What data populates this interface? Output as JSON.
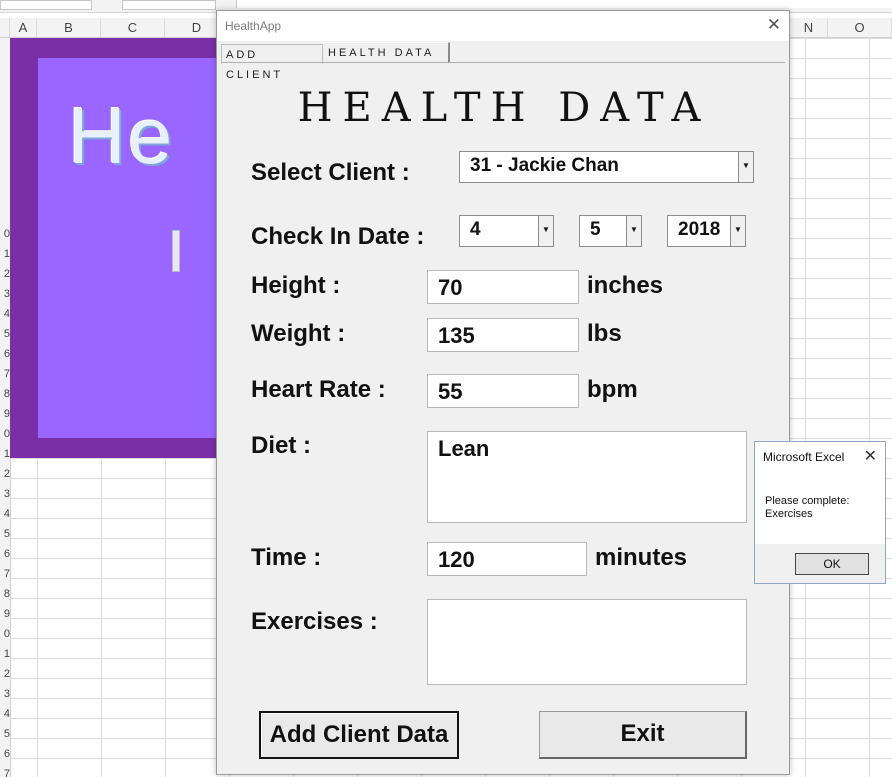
{
  "excel": {
    "columns_left": [
      "A",
      "B",
      "C",
      "D"
    ],
    "columns_right": [
      "N",
      "O"
    ],
    "row_numbers": [
      "0",
      "1",
      "2",
      "3",
      "4",
      "5",
      "6",
      "7",
      "8",
      "9",
      "0",
      "1",
      "2",
      "3",
      "4",
      "5",
      "6",
      "7",
      "8",
      "9",
      "0",
      "1",
      "2",
      "3",
      "4",
      "5",
      "6",
      "7"
    ],
    "banner_text": "He"
  },
  "form": {
    "title": "HealthApp",
    "close_glyph": "✕",
    "tabs": [
      "ADD CLIENT",
      "HEALTH DATA"
    ],
    "heading": "HEALTH DATA",
    "labels": {
      "select_client": "Select Client :",
      "check_in_date": "Check In Date :",
      "height": "Height :",
      "weight": "Weight :",
      "heart_rate": "Heart Rate :",
      "diet": "Diet :",
      "time": "Time :",
      "exercises": "Exercises :"
    },
    "values": {
      "client": "31 - Jackie Chan",
      "month": "4",
      "day": "5",
      "year": "2018",
      "height": "70",
      "weight": "135",
      "heart_rate": "55",
      "diet": "Lean",
      "time": "120",
      "exercises": ""
    },
    "units": {
      "height": "inches",
      "weight": "lbs",
      "heart_rate": "bpm",
      "time": "minutes"
    },
    "buttons": {
      "add": "Add Client Data",
      "exit": "Exit"
    }
  },
  "message_box": {
    "title": "Microsoft Excel",
    "close_glyph": "✕",
    "line1": "Please complete:",
    "line2": "Exercises",
    "ok": "OK"
  },
  "icons": {
    "dropdown_arrow": "▼"
  }
}
